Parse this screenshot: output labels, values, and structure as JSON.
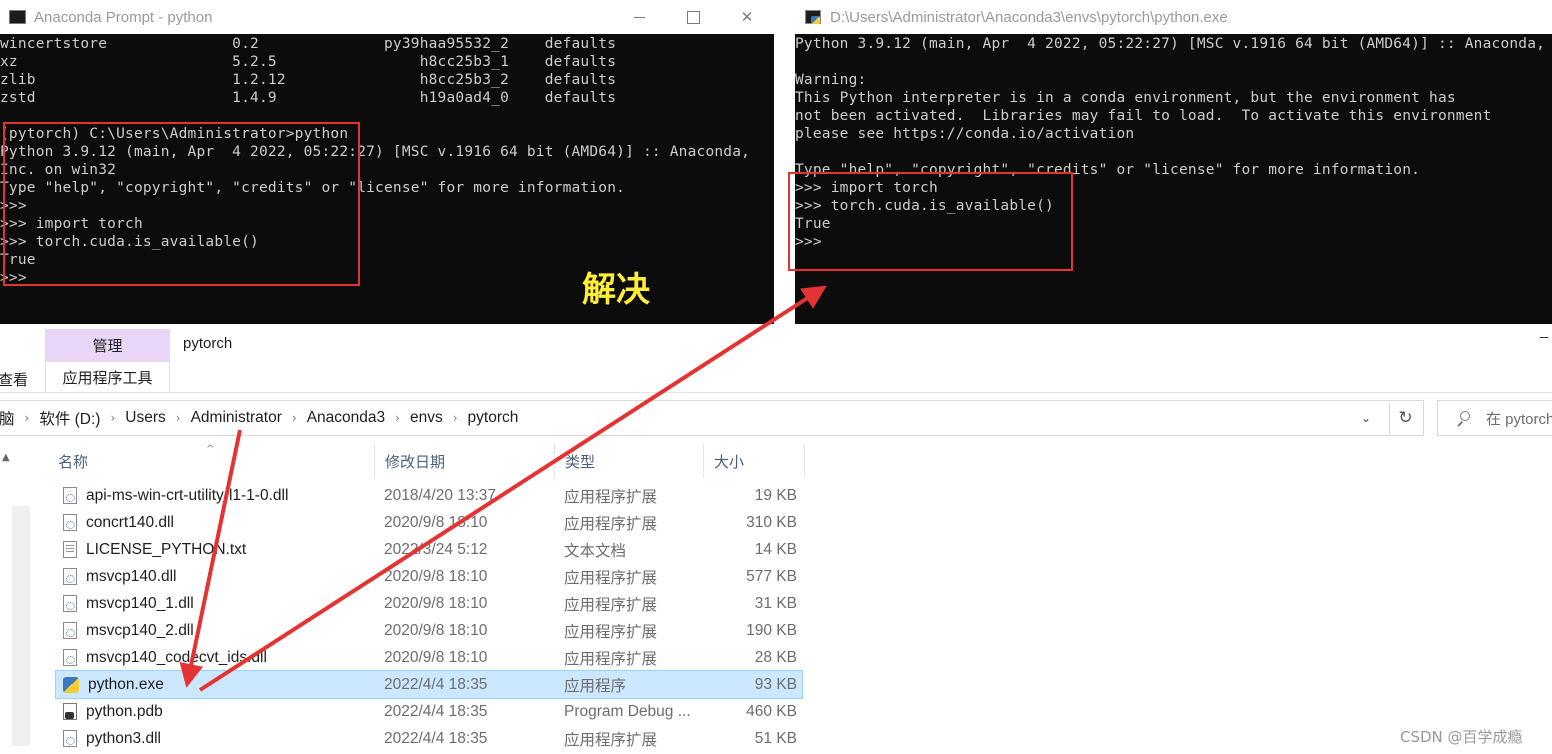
{
  "left_console": {
    "title": "Anaconda Prompt - python",
    "lines": [
      "wincertstore              0.2              py39haa95532_2    defaults",
      "xz                        5.2.5                h8cc25b3_1    defaults",
      "zlib                      1.2.12               h8cc25b3_2    defaults",
      "zstd                      1.4.9                h19a0ad4_0    defaults",
      "",
      "(pytorch) C:\\Users\\Administrator>python",
      "Python 3.9.12 (main, Apr  4 2022, 05:22:27) [MSC v.1916 64 bit (AMD64)] :: Anaconda,",
      "Inc. on win32",
      "Type \"help\", \"copyright\", \"credits\" or \"license\" for more information.",
      ">>>",
      ">>> import torch",
      ">>> torch.cuda.is_available()",
      "True",
      ">>>"
    ]
  },
  "right_console": {
    "title": "D:\\Users\\Administrator\\Anaconda3\\envs\\pytorch\\python.exe",
    "lines": [
      "Python 3.9.12 (main, Apr  4 2022, 05:22:27) [MSC v.1916 64 bit (AMD64)] :: Anaconda,",
      "",
      "Warning:",
      "This Python interpreter is in a conda environment, but the environment has",
      "not been activated.  Libraries may fail to load.  To activate this environment",
      "please see https://conda.io/activation",
      "",
      "Type \"help\", \"copyright\", \"credits\" or \"license\" for more information.",
      ">>> import torch",
      ">>> torch.cuda.is_available()",
      "True",
      ">>>"
    ]
  },
  "annotation": "解决",
  "explorer": {
    "ribbon": {
      "manage_tab": "管理",
      "tools_tab": "应用程序工具",
      "folder_title": "pytorch",
      "view_tab": "查看"
    },
    "address": [
      "软件 (D:)",
      "Users",
      "Administrator",
      "Anaconda3",
      "envs",
      "pytorch"
    ],
    "address_lead": "脑",
    "search_placeholder": "在 pytorch",
    "columns": {
      "name": "名称",
      "date": "修改日期",
      "type": "类型",
      "size": "大小"
    },
    "files": [
      {
        "name": "api-ms-win-crt-utility-l1-1-0.dll",
        "date": "2018/4/20 13:37",
        "type": "应用程序扩展",
        "size": "19 KB",
        "icon": "dll-file-icon"
      },
      {
        "name": "concrt140.dll",
        "date": "2020/9/8 18:10",
        "type": "应用程序扩展",
        "size": "310 KB",
        "icon": "dll-file-icon"
      },
      {
        "name": "LICENSE_PYTHON.txt",
        "date": "2022/3/24 5:12",
        "type": "文本文档",
        "size": "14 KB",
        "icon": "text-file-icon"
      },
      {
        "name": "msvcp140.dll",
        "date": "2020/9/8 18:10",
        "type": "应用程序扩展",
        "size": "577 KB",
        "icon": "dll-file-icon"
      },
      {
        "name": "msvcp140_1.dll",
        "date": "2020/9/8 18:10",
        "type": "应用程序扩展",
        "size": "31 KB",
        "icon": "dll-file-icon"
      },
      {
        "name": "msvcp140_2.dll",
        "date": "2020/9/8 18:10",
        "type": "应用程序扩展",
        "size": "190 KB",
        "icon": "dll-file-icon"
      },
      {
        "name": "msvcp140_codecvt_ids.dll",
        "date": "2020/9/8 18:10",
        "type": "应用程序扩展",
        "size": "28 KB",
        "icon": "dll-file-icon"
      },
      {
        "name": "python.exe",
        "date": "2022/4/4 18:35",
        "type": "应用程序",
        "size": "93 KB",
        "icon": "python-exe-icon",
        "selected": true
      },
      {
        "name": "python.pdb",
        "date": "2022/4/4 18:35",
        "type": "Program Debug ...",
        "size": "460 KB",
        "icon": "pdb-file-icon"
      },
      {
        "name": "python3.dll",
        "date": "2022/4/4 18:35",
        "type": "应用程序扩展",
        "size": "51 KB",
        "icon": "dll-file-icon"
      }
    ]
  },
  "watermark": "CSDN @百学成瘾",
  "colors": {
    "highlight_red": "#e53333",
    "annotation_yellow": "#ffee33",
    "selection_blue": "#cce8ff",
    "console_bg": "#0c0c0c"
  }
}
